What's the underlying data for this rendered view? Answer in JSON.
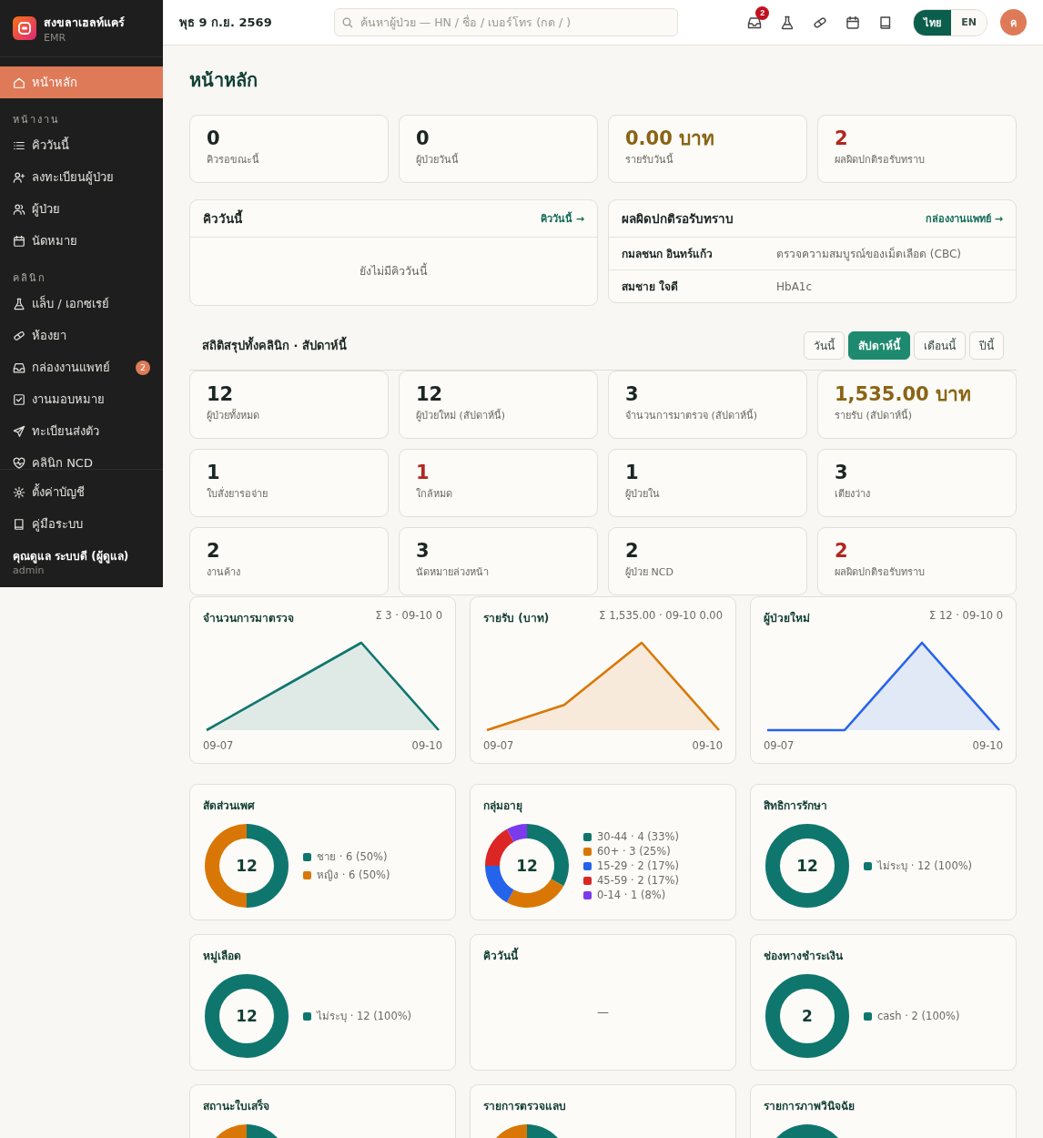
{
  "brand": {
    "name": "สงขลาเฮลท์แคร์",
    "sub": "EMR"
  },
  "sidebar": {
    "items": [
      {
        "kind": "link",
        "label": "หน้าหลัก",
        "selected": true
      },
      {
        "kind": "section",
        "label": "หน้างาน"
      },
      {
        "kind": "link",
        "label": "คิววันนี้",
        "selected": false
      },
      {
        "kind": "link",
        "label": "ลงทะเบียนผู้ป่วย",
        "selected": false
      },
      {
        "kind": "link",
        "label": "ผู้ป่วย",
        "selected": false
      },
      {
        "kind": "link",
        "label": "นัดหมาย",
        "selected": false
      },
      {
        "kind": "section",
        "label": "คลินิก"
      },
      {
        "kind": "link",
        "label": "แล็บ / เอกซเรย์",
        "selected": false
      },
      {
        "kind": "link",
        "label": "ห้องยา",
        "selected": false
      },
      {
        "kind": "link",
        "label": "กล่องงานแพทย์",
        "selected": false,
        "badge": "2"
      },
      {
        "kind": "link",
        "label": "งานมอบหมาย",
        "selected": false
      },
      {
        "kind": "link",
        "label": "ทะเบียนส่งตัว",
        "selected": false
      },
      {
        "kind": "link",
        "label": "คลินิก NCD",
        "selected": false
      }
    ],
    "footer_items": [
      {
        "label": "ตั้งค่าบัญชี"
      },
      {
        "label": "คู่มือระบบ"
      }
    ],
    "user": {
      "name": "คุณดูแล ระบบดี (ผู้ดูแล)",
      "role": "admin"
    }
  },
  "topbar": {
    "date": "พุธ 9 ก.ย. 2569",
    "search": {
      "placeholder": "ค้นหาผู้ป่วย — HN / ชื่อ / เบอร์โทร (กด / )"
    },
    "inbox_badge": "2",
    "languages": [
      {
        "label": "ไทย",
        "selected": true
      },
      {
        "label": "EN",
        "selected": false
      }
    ],
    "avatar": "ค"
  },
  "page_title": "หน้าหลัก",
  "today_stats": [
    {
      "value": "0",
      "label": "คิวรอขณะนี้",
      "kind": "plain"
    },
    {
      "value": "0",
      "label": "ผู้ป่วยวันนี้",
      "kind": "plain"
    },
    {
      "value": "0.00 บาท",
      "label": "รายรับวันนี้",
      "kind": "money"
    },
    {
      "value": "2",
      "label": "ผลผิดปกติรอรับทราบ",
      "kind": "alert"
    }
  ],
  "queue_panel": {
    "title": "คิววันนี้",
    "link": "คิววันนี้ →",
    "empty": "ยังไม่มีคิววันนี้"
  },
  "abnormal_panel": {
    "title": "ผลผิดปกติรอรับทราบ",
    "link": "กล่องงานแพทย์ →",
    "rows": [
      {
        "patient": "กมลชนก อินทร์แก้ว",
        "test": "ตรวจความสมบูรณ์ของเม็ดเลือด (CBC)"
      },
      {
        "patient": "สมชาย ใจดี",
        "test": "HbA1c"
      }
    ]
  },
  "summary": {
    "title": "สถิติสรุปทั้งคลินิก · สัปดาห์นี้",
    "periods": [
      {
        "label": "วันนี้",
        "selected": false
      },
      {
        "label": "สัปดาห์นี้",
        "selected": true
      },
      {
        "label": "เดือนนี้",
        "selected": false
      },
      {
        "label": "ปีนี้",
        "selected": false
      }
    ],
    "stats": [
      {
        "value": "12",
        "label": "ผู้ป่วยทั้งหมด",
        "kind": "plain"
      },
      {
        "value": "12",
        "label": "ผู้ป่วยใหม่ (สัปดาห์นี้)",
        "kind": "plain"
      },
      {
        "value": "3",
        "label": "จำนวนการมาตรวจ (สัปดาห์นี้)",
        "kind": "plain"
      },
      {
        "value": "1,535.00 บาท",
        "label": "รายรับ (สัปดาห์นี้)",
        "kind": "money"
      },
      {
        "value": "1",
        "label": "ใบสั่งยารอจ่าย",
        "kind": "plain"
      },
      {
        "value": "1",
        "label": "ใกล้หมด",
        "kind": "alert"
      },
      {
        "value": "1",
        "label": "ผู้ป่วยใน",
        "kind": "plain"
      },
      {
        "value": "3",
        "label": "เตียงว่าง",
        "kind": "plain"
      },
      {
        "value": "2",
        "label": "งานค้าง",
        "kind": "plain"
      },
      {
        "value": "3",
        "label": "นัดหมายล่วงหน้า",
        "kind": "plain"
      },
      {
        "value": "2",
        "label": "ผู้ป่วย NCD",
        "kind": "plain"
      },
      {
        "value": "2",
        "label": "ผลผิดปกติรอรับทราบ",
        "kind": "alert"
      }
    ]
  },
  "trends": [
    {
      "title": "จำนวนการมาตรวจ",
      "summary": "Σ 3 · 09-10 0",
      "x_start": "09-07",
      "x_end": "09-10",
      "color": "#0f766e"
    },
    {
      "title": "รายรับ (บาท)",
      "summary": "Σ 1,535.00 · 09-10 0.00",
      "x_start": "09-07",
      "x_end": "09-10",
      "color": "#d97706"
    },
    {
      "title": "ผู้ป่วยใหม่",
      "summary": "Σ 12 · 09-10 0",
      "x_start": "09-07",
      "x_end": "09-10",
      "color": "#2563eb"
    }
  ],
  "breakdowns": [
    {
      "title": "สัดส่วนเพศ",
      "kind": "donut",
      "center": "12",
      "legend": [
        {
          "color": "#0f766e"
        },
        {
          "color": "#d97706"
        }
      ],
      "chart_data": {
        "type": "donut",
        "categories": [
          "ชาย",
          "หญิง"
        ],
        "values": [
          50,
          50
        ],
        "value_labels": [
          "· 6 (50%)",
          "· 6 (50%)"
        ]
      }
    },
    {
      "title": "กลุ่มอายุ",
      "kind": "donut",
      "center": "12",
      "legend": [
        {
          "color": "#0f766e"
        },
        {
          "color": "#d97706"
        },
        {
          "color": "#2563eb"
        },
        {
          "color": "#dc2626"
        },
        {
          "color": "#7c3aed"
        }
      ],
      "chart_data": {
        "type": "donut",
        "categories": [
          "30-44",
          "60+",
          "15-29",
          "45-59",
          "0-14"
        ],
        "values": [
          33,
          25,
          17,
          17,
          8
        ],
        "value_labels": [
          "· 4 (33%)",
          "· 3 (25%)",
          "· 2 (17%)",
          "· 2 (17%)",
          "· 1 (8%)"
        ]
      }
    },
    {
      "title": "สิทธิการรักษา",
      "kind": "single",
      "center": "12",
      "legend": [
        {
          "text": "ไม่ระบุ · 12 (100%)",
          "color": "#0f766e"
        }
      ]
    },
    {
      "title": "หมู่เลือด",
      "kind": "single",
      "center": "12",
      "legend": [
        {
          "text": "ไม่ระบุ · 12 (100%)",
          "color": "#0f766e"
        }
      ]
    },
    {
      "title": "คิววันนี้",
      "kind": "empty",
      "empty": "—"
    },
    {
      "title": "ช่องทางชำระเงิน",
      "kind": "single",
      "center": "2",
      "legend": [
        {
          "text": "cash · 2 (100%)",
          "color": "#0f766e"
        }
      ]
    },
    {
      "title": "สถานะใบเสร็จ",
      "kind": "ring",
      "ring": [
        {
          "color": "#0f766e"
        },
        {
          "color": "#d97706"
        }
      ]
    },
    {
      "title": "รายการตรวจแลบ",
      "kind": "ring",
      "ring": [
        {
          "color": "#0f766e"
        },
        {
          "color": "#d97706"
        }
      ]
    },
    {
      "title": "รายการภาพวินิจฉัย",
      "kind": "ring",
      "ring": [
        {
          "color": "#0f766e"
        }
      ]
    }
  ]
}
